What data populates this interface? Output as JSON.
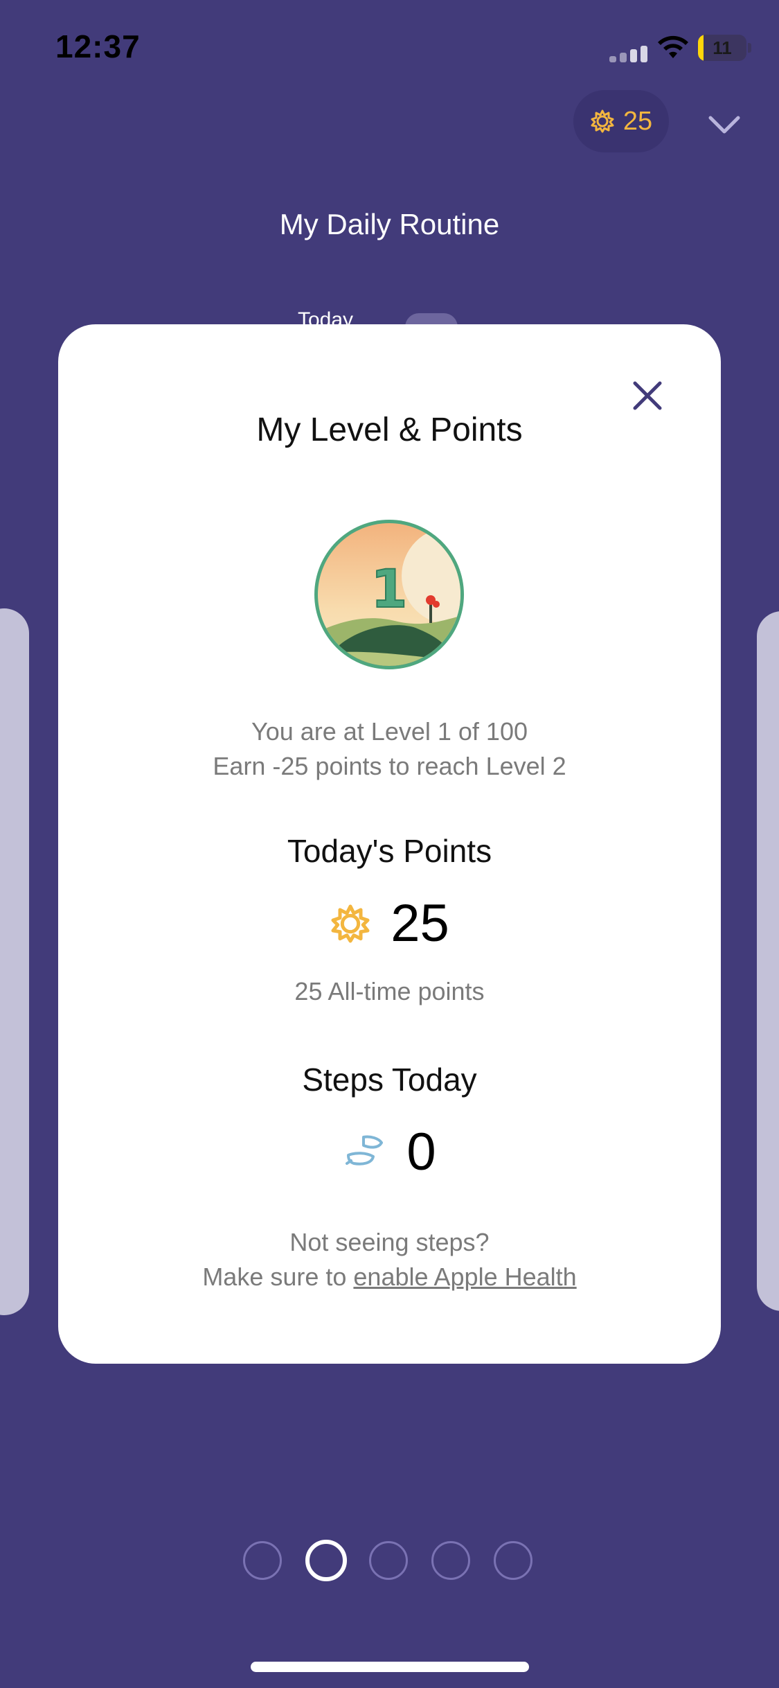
{
  "status_bar": {
    "time": "12:37",
    "battery_label": "11",
    "battery_percent": 11,
    "battery_color": "#ffd60a",
    "icons": [
      "signal-icon",
      "wifi-icon",
      "battery-icon"
    ]
  },
  "header": {
    "points_value": "25",
    "points_icon": "sun-icon",
    "chevron_icon": "chevron-down-icon",
    "title": "My Daily Routine",
    "background_tab_label": "Today"
  },
  "modal": {
    "title": "My Level & Points",
    "close_icon": "close-icon",
    "badge_level": "1",
    "level_line1": "You are at Level 1 of 100",
    "level_line2": "Earn -25 points to reach Level 2",
    "points_title": "Today's Points",
    "points_value": "25",
    "points_icon": "sun-icon",
    "all_time": "25 All-time points",
    "steps_title": "Steps Today",
    "steps_value": "0",
    "steps_icon": "shoe-icon",
    "help_line1": "Not seeing steps?",
    "help_prefix": "Make sure to ",
    "help_link": "enable Apple Health"
  },
  "pagination": {
    "count": 5,
    "active_index": 1
  },
  "colors": {
    "background": "#423b7a",
    "accent_gold": "#f3b63f",
    "close_icon": "#423b7a",
    "badge_ring": "#4fa77f",
    "steps_icon": "#7fb6d6"
  }
}
